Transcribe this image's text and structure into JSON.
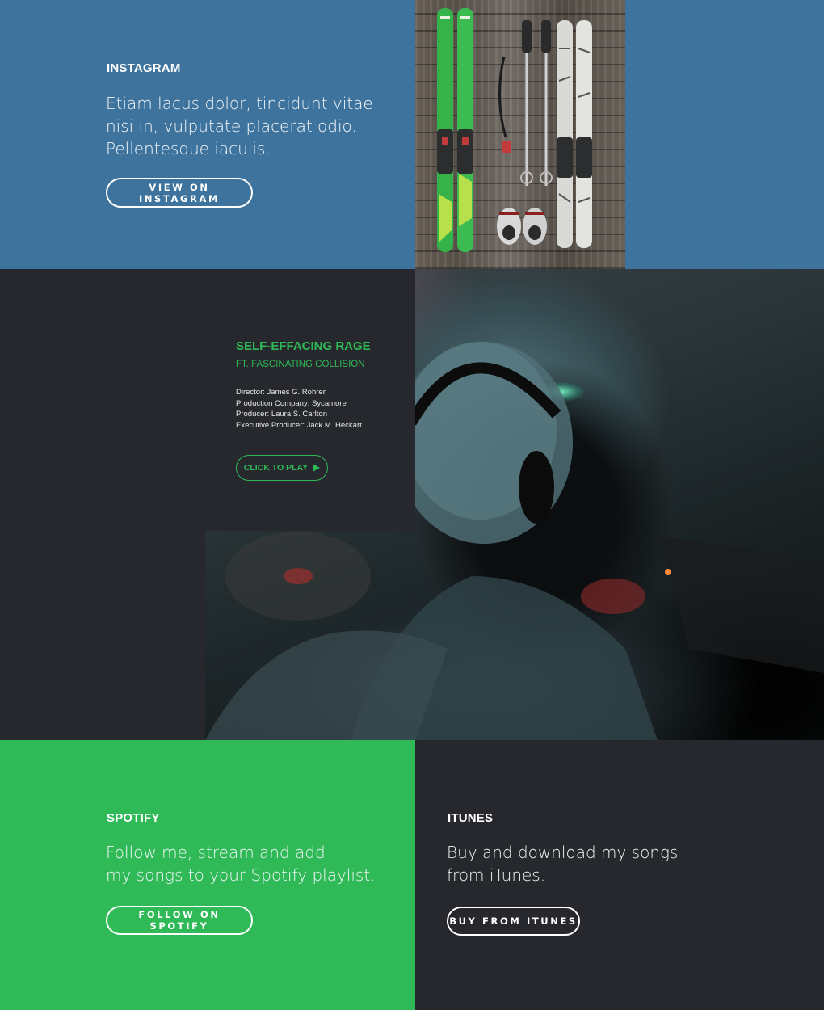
{
  "instagram": {
    "label": "INSTAGRAM",
    "text_line1": "Etiam lacus dolor, tincidunt vitae",
    "text_line2": "nisi in, vulputate placerat odio.",
    "text_line3": "Pellentesque iaculis.",
    "button": "VIEW ON INSTAGRAM",
    "color": "#3d739c"
  },
  "release": {
    "title": "SELF-EFFACING RAGE",
    "subtitle": "FT. FASCINATING COLLISION",
    "credits": [
      "Director: James G. Rohrer",
      "Production Company: Sycamore",
      "Producer: Laura S. Carlton",
      "Executive Producer: Jack M. Heckart"
    ],
    "play_button": "CLICK TO PLAY",
    "play_icon": "play-icon",
    "accent": "#2fba57"
  },
  "spotify": {
    "label": "SPOTIFY",
    "text_line1": "Follow me, stream and add",
    "text_line2": "my songs to your Spotify playlist.",
    "button": "FOLLOW ON SPOTIFY",
    "color": "#2fba57"
  },
  "itunes": {
    "label": "ITUNES",
    "text_line1": "Buy and download my songs",
    "text_line2": "from iTunes.",
    "button": "BUY FROM ITUNES",
    "color": "#26282d"
  }
}
